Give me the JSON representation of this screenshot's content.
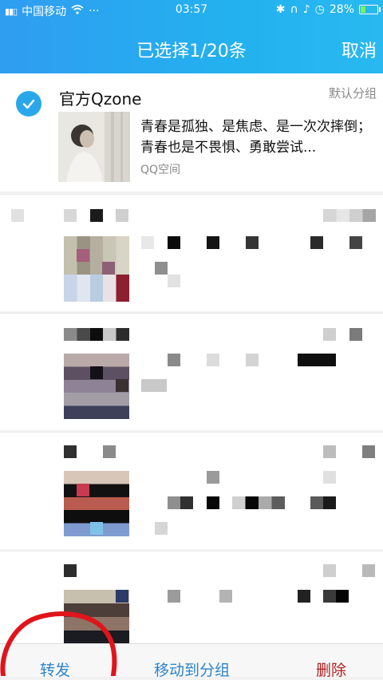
{
  "status_bar": {
    "carrier": "中国移动",
    "time": "03:57",
    "battery": "28%",
    "battery_level": 0.28
  },
  "header": {
    "title": "已选择1/20条",
    "cancel_label": "取消"
  },
  "selected_item": {
    "source_name": "官方Qzone",
    "group": "默认分组",
    "snippet": "青春是孤独、是焦虑、是一次次摔倒；青春也是不畏惧、勇敢尝试...",
    "source_app": "QQ空间",
    "checked": true
  },
  "bottom_bar": {
    "forward_label": "转发",
    "move_label": "移动到分组",
    "delete_label": "删除"
  },
  "colors": {
    "accent": "#2aa7ea",
    "delete": "#b02020",
    "annotation": "#e0151c"
  },
  "icons": [
    "signal-icon",
    "wifi-icon",
    "more-dots-icon",
    "bluetooth-icon",
    "headset-icon",
    "bell-off-icon",
    "alarm-icon",
    "battery-icon",
    "checkmark-icon"
  ]
}
